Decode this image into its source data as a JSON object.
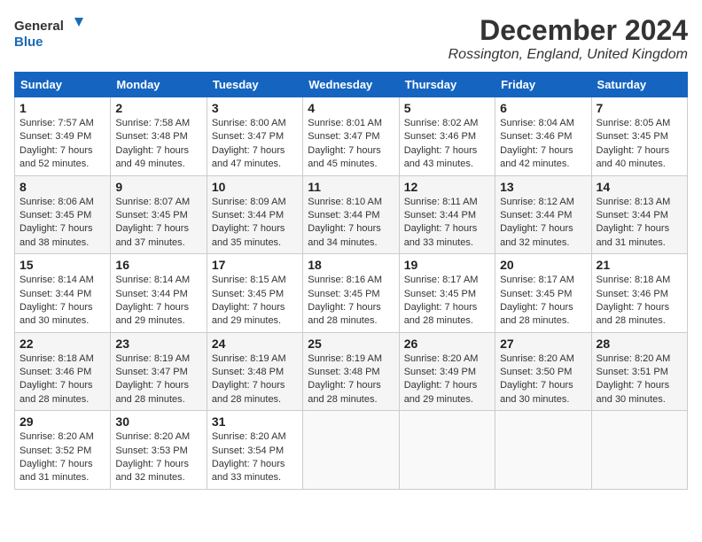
{
  "logo": {
    "line1": "General",
    "line2": "Blue"
  },
  "title": "December 2024",
  "location": "Rossington, England, United Kingdom",
  "headers": [
    "Sunday",
    "Monday",
    "Tuesday",
    "Wednesday",
    "Thursday",
    "Friday",
    "Saturday"
  ],
  "weeks": [
    [
      {
        "day": "1",
        "sunrise": "7:57 AM",
        "sunset": "3:49 PM",
        "daylight": "7 hours and 52 minutes."
      },
      {
        "day": "2",
        "sunrise": "7:58 AM",
        "sunset": "3:48 PM",
        "daylight": "7 hours and 49 minutes."
      },
      {
        "day": "3",
        "sunrise": "8:00 AM",
        "sunset": "3:47 PM",
        "daylight": "7 hours and 47 minutes."
      },
      {
        "day": "4",
        "sunrise": "8:01 AM",
        "sunset": "3:47 PM",
        "daylight": "7 hours and 45 minutes."
      },
      {
        "day": "5",
        "sunrise": "8:02 AM",
        "sunset": "3:46 PM",
        "daylight": "7 hours and 43 minutes."
      },
      {
        "day": "6",
        "sunrise": "8:04 AM",
        "sunset": "3:46 PM",
        "daylight": "7 hours and 42 minutes."
      },
      {
        "day": "7",
        "sunrise": "8:05 AM",
        "sunset": "3:45 PM",
        "daylight": "7 hours and 40 minutes."
      }
    ],
    [
      {
        "day": "8",
        "sunrise": "8:06 AM",
        "sunset": "3:45 PM",
        "daylight": "7 hours and 38 minutes."
      },
      {
        "day": "9",
        "sunrise": "8:07 AM",
        "sunset": "3:45 PM",
        "daylight": "7 hours and 37 minutes."
      },
      {
        "day": "10",
        "sunrise": "8:09 AM",
        "sunset": "3:44 PM",
        "daylight": "7 hours and 35 minutes."
      },
      {
        "day": "11",
        "sunrise": "8:10 AM",
        "sunset": "3:44 PM",
        "daylight": "7 hours and 34 minutes."
      },
      {
        "day": "12",
        "sunrise": "8:11 AM",
        "sunset": "3:44 PM",
        "daylight": "7 hours and 33 minutes."
      },
      {
        "day": "13",
        "sunrise": "8:12 AM",
        "sunset": "3:44 PM",
        "daylight": "7 hours and 32 minutes."
      },
      {
        "day": "14",
        "sunrise": "8:13 AM",
        "sunset": "3:44 PM",
        "daylight": "7 hours and 31 minutes."
      }
    ],
    [
      {
        "day": "15",
        "sunrise": "8:14 AM",
        "sunset": "3:44 PM",
        "daylight": "7 hours and 30 minutes."
      },
      {
        "day": "16",
        "sunrise": "8:14 AM",
        "sunset": "3:44 PM",
        "daylight": "7 hours and 29 minutes."
      },
      {
        "day": "17",
        "sunrise": "8:15 AM",
        "sunset": "3:45 PM",
        "daylight": "7 hours and 29 minutes."
      },
      {
        "day": "18",
        "sunrise": "8:16 AM",
        "sunset": "3:45 PM",
        "daylight": "7 hours and 28 minutes."
      },
      {
        "day": "19",
        "sunrise": "8:17 AM",
        "sunset": "3:45 PM",
        "daylight": "7 hours and 28 minutes."
      },
      {
        "day": "20",
        "sunrise": "8:17 AM",
        "sunset": "3:45 PM",
        "daylight": "7 hours and 28 minutes."
      },
      {
        "day": "21",
        "sunrise": "8:18 AM",
        "sunset": "3:46 PM",
        "daylight": "7 hours and 28 minutes."
      }
    ],
    [
      {
        "day": "22",
        "sunrise": "8:18 AM",
        "sunset": "3:46 PM",
        "daylight": "7 hours and 28 minutes."
      },
      {
        "day": "23",
        "sunrise": "8:19 AM",
        "sunset": "3:47 PM",
        "daylight": "7 hours and 28 minutes."
      },
      {
        "day": "24",
        "sunrise": "8:19 AM",
        "sunset": "3:48 PM",
        "daylight": "7 hours and 28 minutes."
      },
      {
        "day": "25",
        "sunrise": "8:19 AM",
        "sunset": "3:48 PM",
        "daylight": "7 hours and 28 minutes."
      },
      {
        "day": "26",
        "sunrise": "8:20 AM",
        "sunset": "3:49 PM",
        "daylight": "7 hours and 29 minutes."
      },
      {
        "day": "27",
        "sunrise": "8:20 AM",
        "sunset": "3:50 PM",
        "daylight": "7 hours and 30 minutes."
      },
      {
        "day": "28",
        "sunrise": "8:20 AM",
        "sunset": "3:51 PM",
        "daylight": "7 hours and 30 minutes."
      }
    ],
    [
      {
        "day": "29",
        "sunrise": "8:20 AM",
        "sunset": "3:52 PM",
        "daylight": "7 hours and 31 minutes."
      },
      {
        "day": "30",
        "sunrise": "8:20 AM",
        "sunset": "3:53 PM",
        "daylight": "7 hours and 32 minutes."
      },
      {
        "day": "31",
        "sunrise": "8:20 AM",
        "sunset": "3:54 PM",
        "daylight": "7 hours and 33 minutes."
      },
      null,
      null,
      null,
      null
    ]
  ]
}
